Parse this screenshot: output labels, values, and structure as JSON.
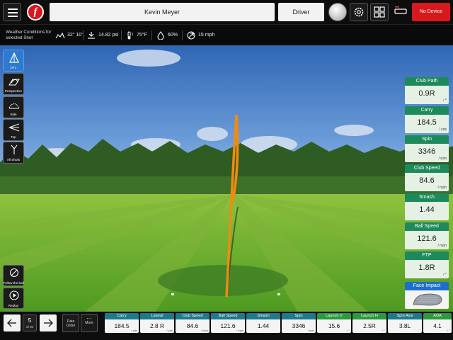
{
  "topbar": {
    "logo_letter": "f",
    "player_name": "Kevin Meyer",
    "club": "Driver",
    "device_status": "No Device"
  },
  "weather": {
    "label": "Weather Conditions for selected Shot",
    "location_icon": "mountain-location-icon",
    "latitude": "32° 10'",
    "pressure": "14.82 psi",
    "temperature": "75°F",
    "humidity": "60%",
    "wind": "15 mph"
  },
  "views": [
    {
      "id": "dtl",
      "label": "DTL",
      "icon": "dtl-view-icon",
      "active": true
    },
    {
      "id": "perspective",
      "label": "Perspective",
      "icon": "perspective-view-icon",
      "active": false
    },
    {
      "id": "side",
      "label": "Side",
      "icon": "side-view-icon",
      "active": false
    },
    {
      "id": "top",
      "label": "Top",
      "icon": "top-view-icon",
      "active": false
    },
    {
      "id": "all-shots",
      "label": "All Shots",
      "icon": "all-shots-icon",
      "active": false
    }
  ],
  "playback": {
    "follow_label": "Follow the ball",
    "replay_label": "Replay"
  },
  "tiles": [
    {
      "label": "Club Path",
      "value": "0.9R",
      "unit": "/ °"
    },
    {
      "label": "Carry",
      "value": "184.5",
      "unit": "/ yds"
    },
    {
      "label": "Spin",
      "value": "3346",
      "unit": "/ rpm"
    },
    {
      "label": "Club Speed",
      "value": "84.6",
      "unit": "/ mph"
    },
    {
      "label": "Smash",
      "value": "1.44",
      "unit": ""
    },
    {
      "label": "Ball Speed",
      "value": "121.6",
      "unit": "/ mph"
    },
    {
      "label": "FTP",
      "value": "1.8R",
      "unit": "/ °"
    }
  ],
  "face_impact": {
    "label": "Face Impact"
  },
  "bottom": {
    "shot_number": "5",
    "shot_of": "of 30",
    "data_order_label": "Data Order",
    "more_label": "More",
    "columns": [
      {
        "label": "Carry",
        "value": "184.5",
        "unit": "/ yds",
        "color": "#1d7a8b"
      },
      {
        "label": "Lateral",
        "value": "2.8 R",
        "unit": "/ yds",
        "color": "#1d7a8b"
      },
      {
        "label": "Club Speed",
        "value": "84.6",
        "unit": "/ mph",
        "color": "#1d7a8b"
      },
      {
        "label": "Ball Speed",
        "value": "121.6",
        "unit": "/ mph",
        "color": "#1d7a8b"
      },
      {
        "label": "Smash",
        "value": "1.44",
        "unit": "",
        "color": "#1d7a8b"
      },
      {
        "label": "Spin",
        "value": "3346",
        "unit": "/ rpm",
        "color": "#1d7a8b"
      },
      {
        "label": "Launch V",
        "value": "15.6",
        "unit": "/ °",
        "color": "#2a9a3e"
      },
      {
        "label": "Launch H",
        "value": "2.5R",
        "unit": "/ °",
        "color": "#2a9a3e"
      },
      {
        "label": "Spin Axis",
        "value": "3.8L",
        "unit": "/ °",
        "color": "#1d7a8b"
      },
      {
        "label": "AOA",
        "value": "4.1",
        "unit": "/ °",
        "color": "#2a9a3e"
      }
    ]
  }
}
